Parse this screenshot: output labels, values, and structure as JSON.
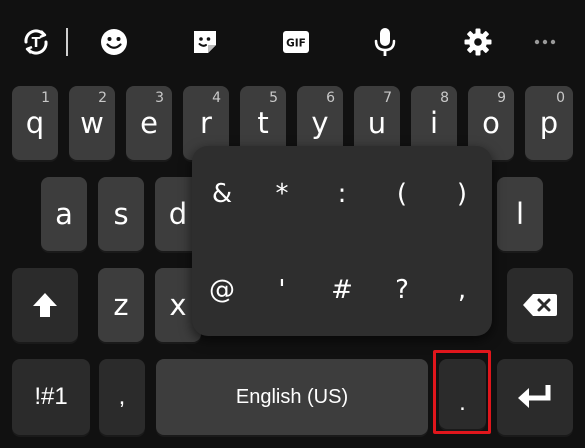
{
  "toolbar": {
    "icons": [
      "translate-sync-icon",
      "emoji-icon",
      "sticker-icon",
      "gif-icon",
      "microphone-icon",
      "settings-icon",
      "more-icon"
    ],
    "gif_label": "GIF"
  },
  "rows": {
    "row1": [
      {
        "letter": "q",
        "hint": "1"
      },
      {
        "letter": "w",
        "hint": "2"
      },
      {
        "letter": "e",
        "hint": "3"
      },
      {
        "letter": "r",
        "hint": "4"
      },
      {
        "letter": "t",
        "hint": "5"
      },
      {
        "letter": "y",
        "hint": "6"
      },
      {
        "letter": "u",
        "hint": "7"
      },
      {
        "letter": "i",
        "hint": "8"
      },
      {
        "letter": "o",
        "hint": "9"
      },
      {
        "letter": "p",
        "hint": "0"
      }
    ],
    "row2": [
      "a",
      "s",
      "d",
      "l"
    ],
    "row3": [
      "z",
      "x"
    ]
  },
  "bottom": {
    "symbols_label": "!#1",
    "comma_label": ",",
    "space_label": "English (US)",
    "period_label": "."
  },
  "popup": {
    "row1": [
      "&",
      "*",
      ":",
      "(",
      ")"
    ],
    "row2": [
      "@",
      "'",
      "#",
      "?",
      ","
    ]
  },
  "colors": {
    "background": "#111111",
    "key": "#3d3d3d",
    "key_dark": "#2b2b2b",
    "popup": "#2e2e2e",
    "highlight": "#e0161c"
  }
}
